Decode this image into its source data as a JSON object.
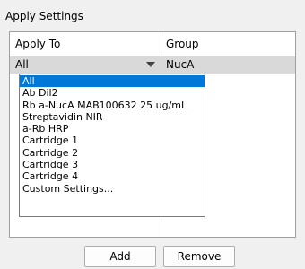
{
  "group_title": "Apply Settings",
  "columns": {
    "apply_to": "Apply To",
    "group": "Group"
  },
  "row": {
    "apply_to_value": "All",
    "group_value": "NucA"
  },
  "dropdown": {
    "selected_index": 0,
    "options": [
      "All",
      "Ab Dil2",
      "Rb a-NucA MAB100632 25 ug/mL",
      "Streptavidin NIR",
      "a-Rb HRP",
      "Cartridge 1",
      "Cartridge 2",
      "Cartridge 3",
      "Cartridge 4",
      "Custom Settings..."
    ]
  },
  "buttons": {
    "add": "Add",
    "remove": "Remove"
  },
  "colors": {
    "selection": "#0078d7",
    "row_highlight": "#d9d9d9"
  }
}
